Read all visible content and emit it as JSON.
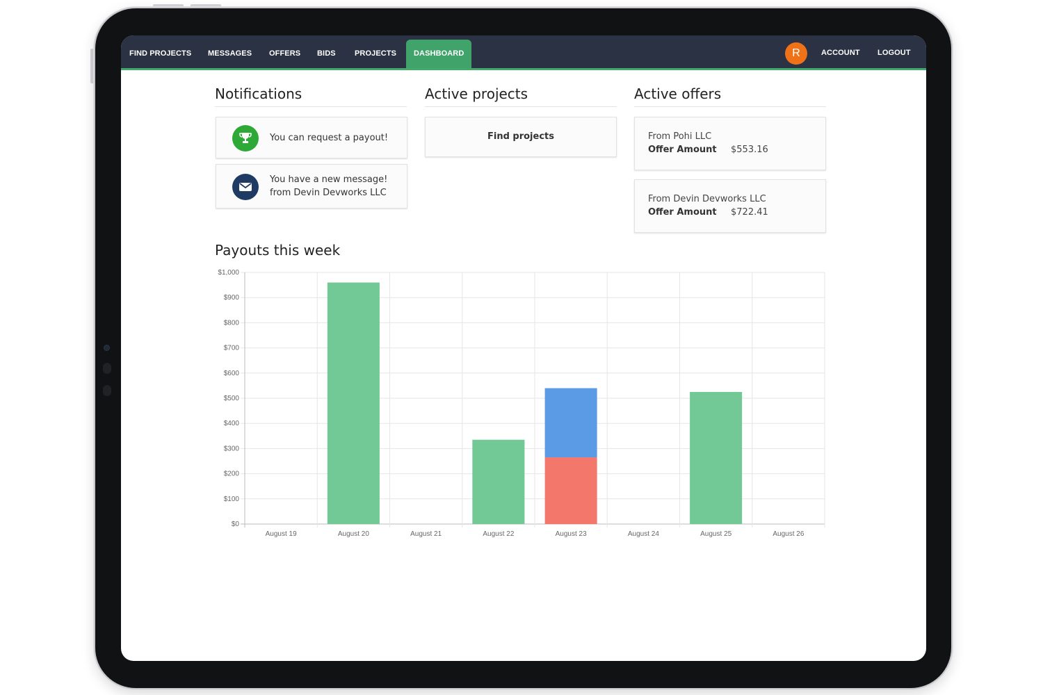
{
  "nav": {
    "items": [
      {
        "label": "FIND PROJECTS"
      },
      {
        "label": "MESSAGES"
      },
      {
        "label": "OFFERS"
      },
      {
        "label": "BIDS"
      },
      {
        "label": "PROJECTS"
      },
      {
        "label": "DASHBOARD",
        "active": true
      }
    ],
    "avatar_initial": "R",
    "account_label": "ACCOUNT",
    "logout_label": "LOGOUT"
  },
  "notifications": {
    "title": "Notifications",
    "items": [
      {
        "icon": "trophy-icon",
        "color": "#2ea836",
        "line1": "You can request a payout!",
        "line2": ""
      },
      {
        "icon": "envelope-icon",
        "color": "#1f3a63",
        "line1": "You have a new message!",
        "line2": "from Devin Devworks LLC"
      }
    ]
  },
  "active_projects": {
    "title": "Active projects",
    "find_label": "Find projects"
  },
  "active_offers": {
    "title": "Active offers",
    "items": [
      {
        "from": "From Pohi LLC",
        "amount_label": "Offer Amount",
        "amount": "$553.16"
      },
      {
        "from": "From Devin Devworks LLC",
        "amount_label": "Offer Amount",
        "amount": "$722.41"
      }
    ]
  },
  "payouts": {
    "title": "Payouts this week"
  },
  "chart_data": {
    "type": "bar",
    "stacked": true,
    "categories": [
      "August 19",
      "August 20",
      "August 21",
      "August 22",
      "August 23",
      "August 24",
      "August 25",
      "August 26"
    ],
    "series": [
      {
        "color": "#72c996",
        "values": [
          0,
          960,
          0,
          335,
          0,
          0,
          525,
          0
        ]
      },
      {
        "color": "#f4776b",
        "values": [
          0,
          0,
          0,
          0,
          265,
          0,
          0,
          0
        ]
      },
      {
        "color": "#5b9be6",
        "values": [
          0,
          0,
          0,
          0,
          275,
          0,
          0,
          0
        ]
      }
    ],
    "yticks": [
      "$0",
      "$100",
      "$200",
      "$300",
      "$400",
      "$500",
      "$600",
      "$700",
      "$800",
      "$900",
      "$1,000"
    ],
    "ylim": [
      0,
      1000
    ],
    "grid": true
  }
}
